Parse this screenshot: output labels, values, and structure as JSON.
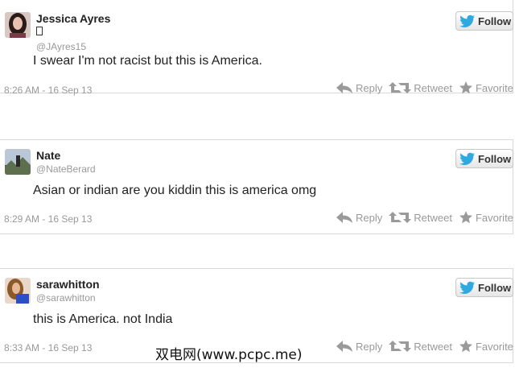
{
  "tweets": [
    {
      "name": "Jessica Ayres",
      "handle": "@JAyres15",
      "text": "I swear I'm not racist but this is America.",
      "time": "8:26 AM - 16 Sep 13"
    },
    {
      "name": "Nate",
      "handle": "@NateBerard",
      "text": "Asian or indian are you kiddin this is america omg",
      "time": "8:29 AM - 16 Sep 13"
    },
    {
      "name": "sarawhitton",
      "handle": "@sarawhitton",
      "text": "this is America. not India",
      "time": "8:33 AM - 16 Sep 13"
    }
  ],
  "labels": {
    "follow": "Follow",
    "reply": "Reply",
    "retweet": "Retweet",
    "favorite": "Favorite"
  },
  "watermark": "双电网(www.pcpc.me)",
  "colors": {
    "twitter_blue": "#2fa9e0",
    "action_gray": "#999999",
    "border": "#d9d9d9"
  }
}
